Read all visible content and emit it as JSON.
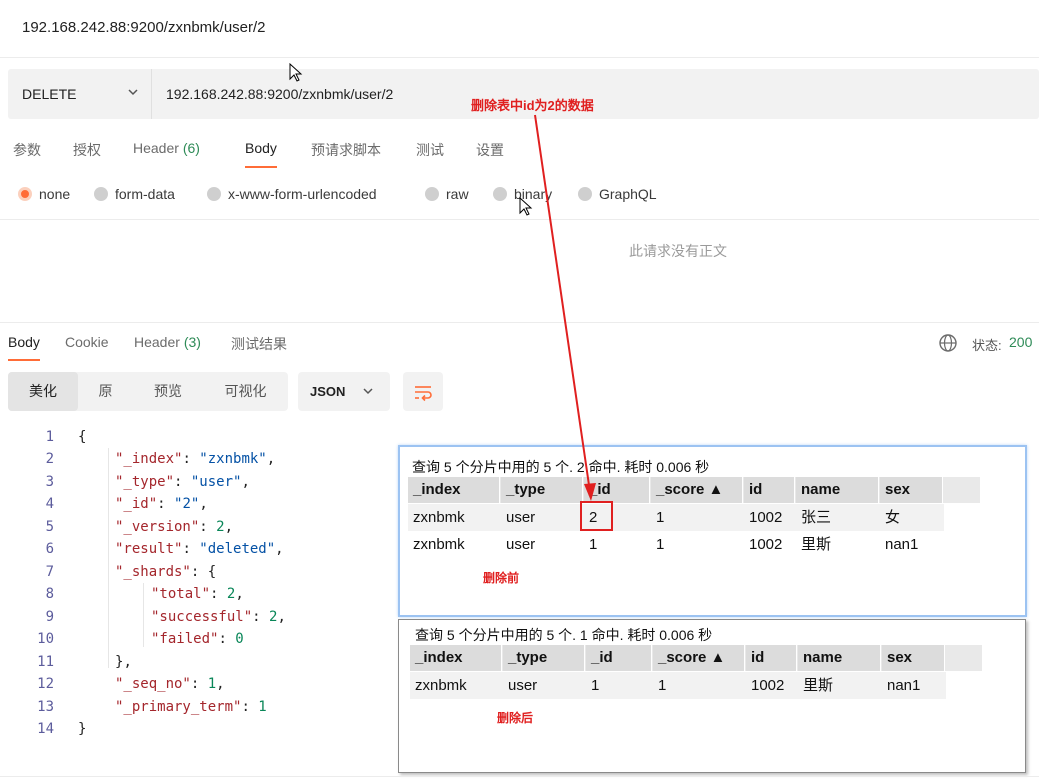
{
  "window": {
    "title": "192.168.242.88:9200/zxnbmk/user/2"
  },
  "request": {
    "method": "DELETE",
    "url": "192.168.242.88:9200/zxnbmk/user/2"
  },
  "request_tabs": [
    {
      "label": "参数"
    },
    {
      "label": "授权"
    },
    {
      "label": "Header",
      "count": "(6)"
    },
    {
      "label": "Body"
    },
    {
      "label": "预请求脚本"
    },
    {
      "label": "测试"
    },
    {
      "label": "设置"
    }
  ],
  "body_types": [
    "none",
    "form-data",
    "x-www-form-urlencoded",
    "raw",
    "binary",
    "GraphQL"
  ],
  "body_empty_message": "此请求没有正文",
  "response_tabs": [
    {
      "label": "Body"
    },
    {
      "label": "Cookie"
    },
    {
      "label": "Header",
      "count": "(3)"
    },
    {
      "label": "测试结果"
    }
  ],
  "status": {
    "label": "状态:",
    "value": "200"
  },
  "view_modes": [
    "美化",
    "原",
    "预览",
    "可视化"
  ],
  "format": "JSON",
  "code": {
    "line_numbers": [
      "1",
      "2",
      "3",
      "4",
      "5",
      "6",
      "7",
      "8",
      "9",
      "10",
      "11",
      "12",
      "13",
      "14"
    ],
    "open": "{",
    "close": "}",
    "index_key": "\"_index\"",
    "index_val": "\"zxnbmk\"",
    "type_key": "\"_type\"",
    "type_val": "\"user\"",
    "id_key": "\"_id\"",
    "id_val": "\"2\"",
    "version_key": "\"_version\"",
    "version_val": "2",
    "result_key": "\"result\"",
    "result_val": "\"deleted\"",
    "shards_key": "\"_shards\"",
    "total_key": "\"total\"",
    "total_val": "2",
    "successful_key": "\"successful\"",
    "successful_val": "2",
    "failed_key": "\"failed\"",
    "failed_val": "0",
    "seq_key": "\"_seq_no\"",
    "seq_val": "1",
    "term_key": "\"_primary_term\"",
    "term_val": "1"
  },
  "annotation": "删除表中id为2的数据",
  "before_panel": {
    "summary": "查询 5 个分片中用的 5 个. 2 命中. 耗时 0.006 秒",
    "headers": [
      "_index",
      "_type",
      "_id",
      "_score ▲",
      "id",
      "name",
      "sex"
    ],
    "rows": [
      [
        "zxnbmk",
        "user",
        "2",
        "1",
        "1002",
        "张三",
        "女"
      ],
      [
        "zxnbmk",
        "user",
        "1",
        "1",
        "1002",
        "里斯",
        "nan1"
      ]
    ],
    "note": "删除前"
  },
  "after_panel": {
    "summary": "查询 5 个分片中用的 5 个. 1 命中. 耗时 0.006 秒",
    "headers": [
      "_index",
      "_type",
      "_id",
      "_score ▲",
      "id",
      "name",
      "sex"
    ],
    "rows": [
      [
        "zxnbmk",
        "user",
        "1",
        "1",
        "1002",
        "里斯",
        "nan1"
      ]
    ],
    "note": "删除后"
  },
  "colors": {
    "accent": "#ff6c37",
    "success": "#2e8b57",
    "annotation": "#e02020",
    "json_key": "#a4262c",
    "json_string": "#0451a5",
    "json_number": "#098658"
  }
}
